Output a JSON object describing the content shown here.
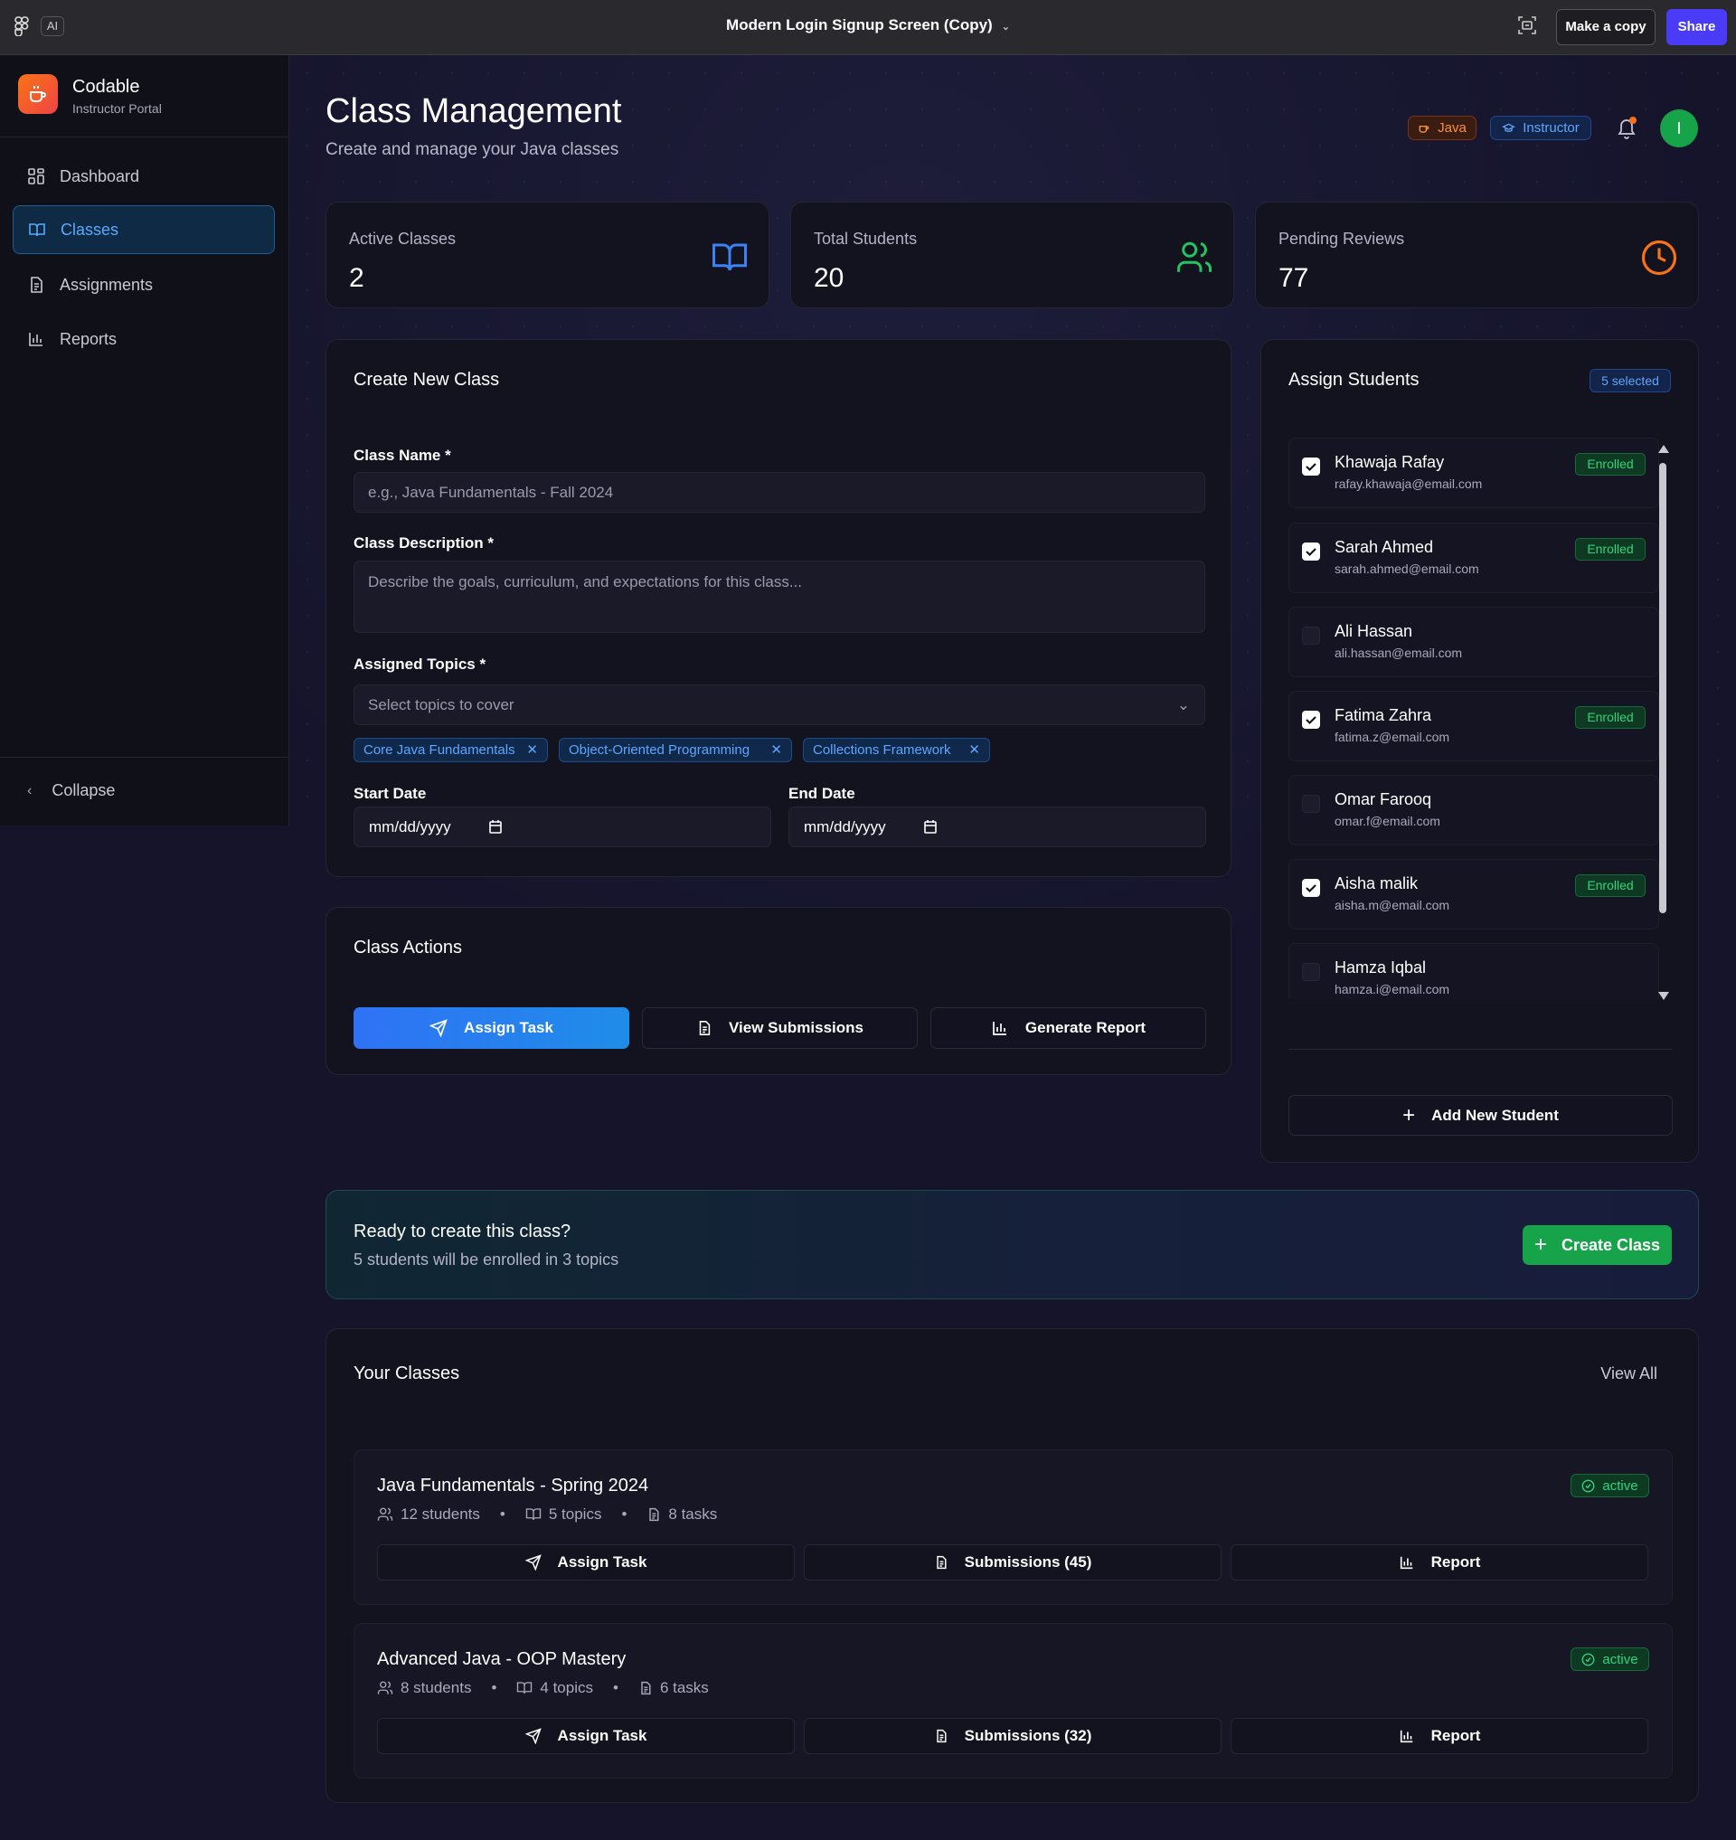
{
  "topbar": {
    "ai_label": "AI",
    "title": "Modern Login Signup Screen (Copy)",
    "make_copy": "Make a copy",
    "share": "Share"
  },
  "brand": {
    "name": "Codable",
    "subtitle": "Instructor Portal"
  },
  "nav": {
    "items": [
      {
        "label": "Dashboard",
        "icon": "grid-icon"
      },
      {
        "label": "Classes",
        "icon": "book-icon",
        "active": true
      },
      {
        "label": "Assignments",
        "icon": "file-icon"
      },
      {
        "label": "Reports",
        "icon": "bar-chart-icon"
      }
    ],
    "collapse": "Collapse"
  },
  "header": {
    "title": "Class Management",
    "subtitle": "Create and manage your Java classes",
    "badge_java": "Java",
    "badge_instructor": "Instructor",
    "avatar_initial": "I"
  },
  "stats": [
    {
      "label": "Active Classes",
      "value": "2",
      "icon": "book-open-icon",
      "color": "#3b82f6"
    },
    {
      "label": "Total Students",
      "value": "20",
      "icon": "users-icon",
      "color": "#22c55e"
    },
    {
      "label": "Pending Reviews",
      "value": "77",
      "icon": "clock-icon",
      "color": "#f97316"
    }
  ],
  "create_form": {
    "title": "Create New Class",
    "class_name_label": "Class Name *",
    "class_name_placeholder": "e.g., Java Fundamentals - Fall 2024",
    "desc_label": "Class Description *",
    "desc_placeholder": "Describe the goals, curriculum, and expectations for this class...",
    "topics_label": "Assigned Topics *",
    "topics_placeholder": "Select topics to cover",
    "topics": [
      "Core Java Fundamentals",
      "Object-Oriented Programming",
      "Collections Framework"
    ],
    "start_label": "Start Date",
    "end_label": "End Date",
    "date_placeholder": "mm/dd/yyyy"
  },
  "actions": {
    "title": "Class Actions",
    "assign": "Assign Task",
    "view": "View Submissions",
    "report": "Generate Report"
  },
  "assign_students": {
    "title": "Assign Students",
    "selected": "5 selected",
    "enrolled_label": "Enrolled",
    "students": [
      {
        "name": "Khawaja Rafay",
        "email": "rafay.khawaja@email.com",
        "checked": true
      },
      {
        "name": "Sarah Ahmed",
        "email": "sarah.ahmed@email.com",
        "checked": true
      },
      {
        "name": "Ali Hassan",
        "email": "ali.hassan@email.com",
        "checked": false
      },
      {
        "name": "Fatima Zahra",
        "email": "fatima.z@email.com",
        "checked": true
      },
      {
        "name": "Omar Farooq",
        "email": "omar.f@email.com",
        "checked": false
      },
      {
        "name": "Aisha malik",
        "email": "aisha.m@email.com",
        "checked": true
      },
      {
        "name": "Hamza Iqbal",
        "email": "hamza.i@email.com",
        "checked": false
      }
    ],
    "add_button": "Add New Student"
  },
  "ready": {
    "title": "Ready to create this class?",
    "subtitle": "5 students will be enrolled in 3 topics",
    "button": "Create Class"
  },
  "your_classes": {
    "title": "Your Classes",
    "view_all": "View All",
    "classes": [
      {
        "name": "Java Fundamentals - Spring 2024",
        "students": "12 students",
        "topics": "5 topics",
        "tasks": "8 tasks",
        "status": "active",
        "assign": "Assign Task",
        "submissions": "Submissions (45)",
        "report": "Report"
      },
      {
        "name": "Advanced Java - OOP Mastery",
        "students": "8 students",
        "topics": "4 topics",
        "tasks": "6 tasks",
        "status": "active",
        "assign": "Assign Task",
        "submissions": "Submissions (32)",
        "report": "Report"
      }
    ]
  }
}
